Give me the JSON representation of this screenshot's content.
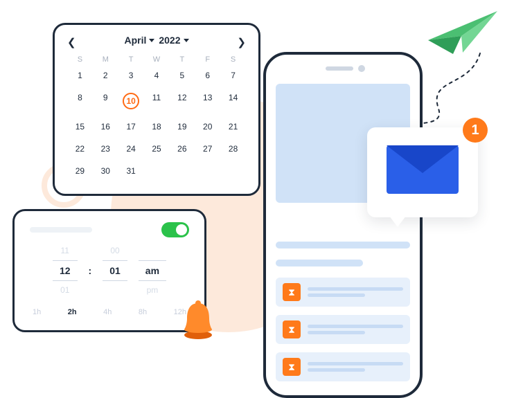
{
  "calendar": {
    "month": "April",
    "year": "2022",
    "dow": [
      "S",
      "M",
      "T",
      "W",
      "T",
      "F",
      "S"
    ],
    "days": [
      "1",
      "2",
      "3",
      "4",
      "5",
      "6",
      "7",
      "8",
      "9",
      "10",
      "11",
      "12",
      "13",
      "14",
      "15",
      "16",
      "17",
      "18",
      "19",
      "20",
      "21",
      "22",
      "23",
      "24",
      "25",
      "26",
      "27",
      "28",
      "29",
      "30",
      "31"
    ],
    "selected_index": 9
  },
  "time": {
    "hour_prev": "11",
    "hour": "12",
    "hour_next": "01",
    "minute_prev": "00",
    "minute": "01",
    "minute_next": "",
    "period": "am",
    "period_next": "pm",
    "separator": ":",
    "toggle_on": true,
    "durations": [
      "1h",
      "2h",
      "4h",
      "8h",
      "12h"
    ],
    "duration_selected_index": 1
  },
  "notification": {
    "badge_count": "1"
  },
  "colors": {
    "accent_orange": "#ff7a1a",
    "accent_green": "#2bc24a",
    "blue": "#2a5fe8",
    "dark": "#1e2a3a"
  }
}
